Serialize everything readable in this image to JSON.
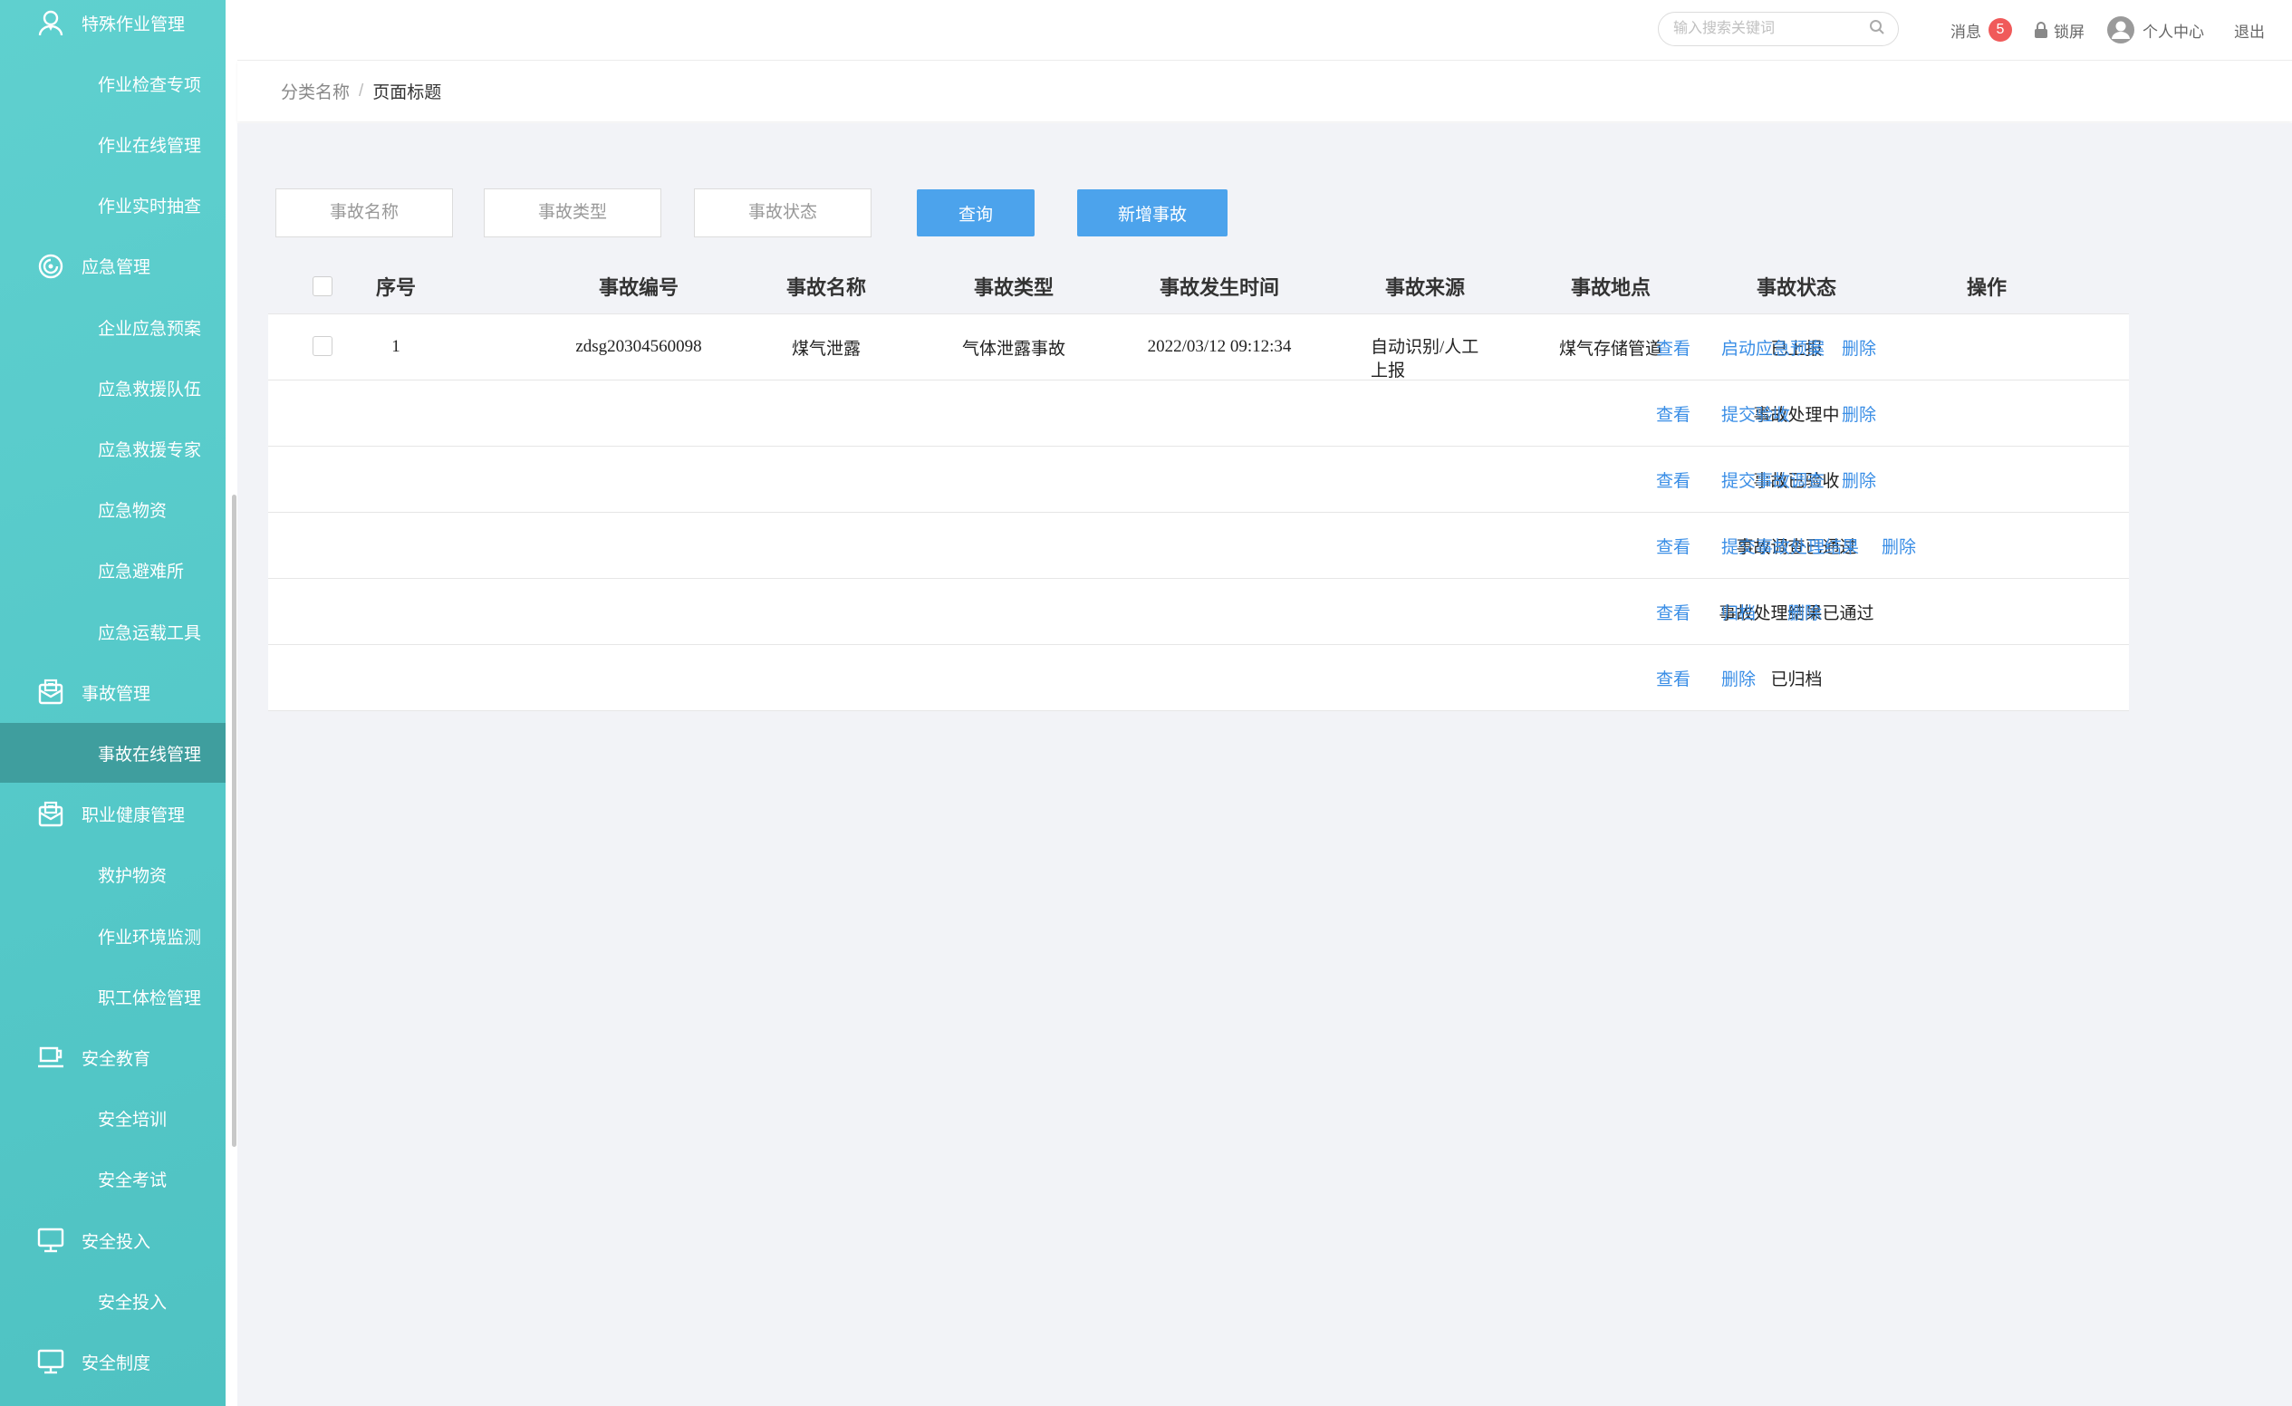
{
  "colors": {
    "sidebar": "#56cacb",
    "sidebar_active": "#3f9e9e",
    "primary": "#4ca3ec",
    "link": "#3a8ee6",
    "badge": "#f05a5a",
    "main_bg": "#f2f3f7"
  },
  "sidebar": {
    "items": [
      {
        "label": "特殊作业管理",
        "type": "group",
        "icon": "user-tie-icon"
      },
      {
        "label": "作业检查专项",
        "type": "sub"
      },
      {
        "label": "作业在线管理",
        "type": "sub"
      },
      {
        "label": "作业实时抽查",
        "type": "sub"
      },
      {
        "label": "应急管理",
        "type": "group",
        "icon": "emergency-icon"
      },
      {
        "label": "企业应急预案",
        "type": "sub"
      },
      {
        "label": "应急救援队伍",
        "type": "sub"
      },
      {
        "label": "应急救援专家",
        "type": "sub"
      },
      {
        "label": "应急物资",
        "type": "sub"
      },
      {
        "label": "应急避难所",
        "type": "sub"
      },
      {
        "label": "应急运载工具",
        "type": "sub"
      },
      {
        "label": "事故管理",
        "type": "group",
        "icon": "envelope-icon"
      },
      {
        "label": "事故在线管理",
        "type": "sub",
        "active": true
      },
      {
        "label": "职业健康管理",
        "type": "group",
        "icon": "envelope-icon"
      },
      {
        "label": "救护物资",
        "type": "sub"
      },
      {
        "label": "作业环境监测",
        "type": "sub"
      },
      {
        "label": "职工体检管理",
        "type": "sub"
      },
      {
        "label": "安全教育",
        "type": "group",
        "icon": "cup-icon"
      },
      {
        "label": "安全培训",
        "type": "sub"
      },
      {
        "label": "安全考试",
        "type": "sub"
      },
      {
        "label": "安全投入",
        "type": "group",
        "icon": "monitor-icon"
      },
      {
        "label": "安全投入",
        "type": "sub"
      },
      {
        "label": "安全制度",
        "type": "group",
        "icon": "monitor-icon"
      }
    ]
  },
  "topbar": {
    "search_placeholder": "输入搜索关键词",
    "messages_label": "消息",
    "messages_count": "5",
    "lock_label": "锁屏",
    "profile_label": "个人中心",
    "logout_label": "退出"
  },
  "breadcrumb": {
    "category": "分类名称",
    "separator": "/",
    "page": "页面标题"
  },
  "filters": {
    "name_placeholder": "事故名称",
    "type_placeholder": "事故类型",
    "status_placeholder": "事故状态",
    "query_button": "查询",
    "add_button": "新增事故"
  },
  "table": {
    "headers": [
      "序号",
      "事故编号",
      "事故名称",
      "事故类型",
      "事故发生时间",
      "事故来源",
      "事故地点",
      "事故状态",
      "操作"
    ],
    "rows": [
      {
        "index": "1",
        "code": "zdsg20304560098",
        "name": "煤气泄露",
        "type": "气体泄露事故",
        "time": "2022/03/12 09:12:34",
        "source": "自动识别/人工上报",
        "location": "煤气存储管道",
        "status": "已上报",
        "actions": [
          "查看",
          "启动应急预案",
          "删除"
        ]
      },
      {
        "status": "事故处理中",
        "actions": [
          "查看",
          "提交验收",
          "删除"
        ]
      },
      {
        "status": "事故已验收",
        "actions": [
          "查看",
          "提交事故调查",
          "删除"
        ]
      },
      {
        "status": "事故调查已通过",
        "actions": [
          "查看",
          "提交事故处理结果",
          "删除"
        ]
      },
      {
        "status": "事故处理结果已通过",
        "actions": [
          "查看",
          "归档",
          "删除"
        ]
      },
      {
        "status": "已归档",
        "actions": [
          "查看",
          "删除"
        ]
      }
    ]
  }
}
